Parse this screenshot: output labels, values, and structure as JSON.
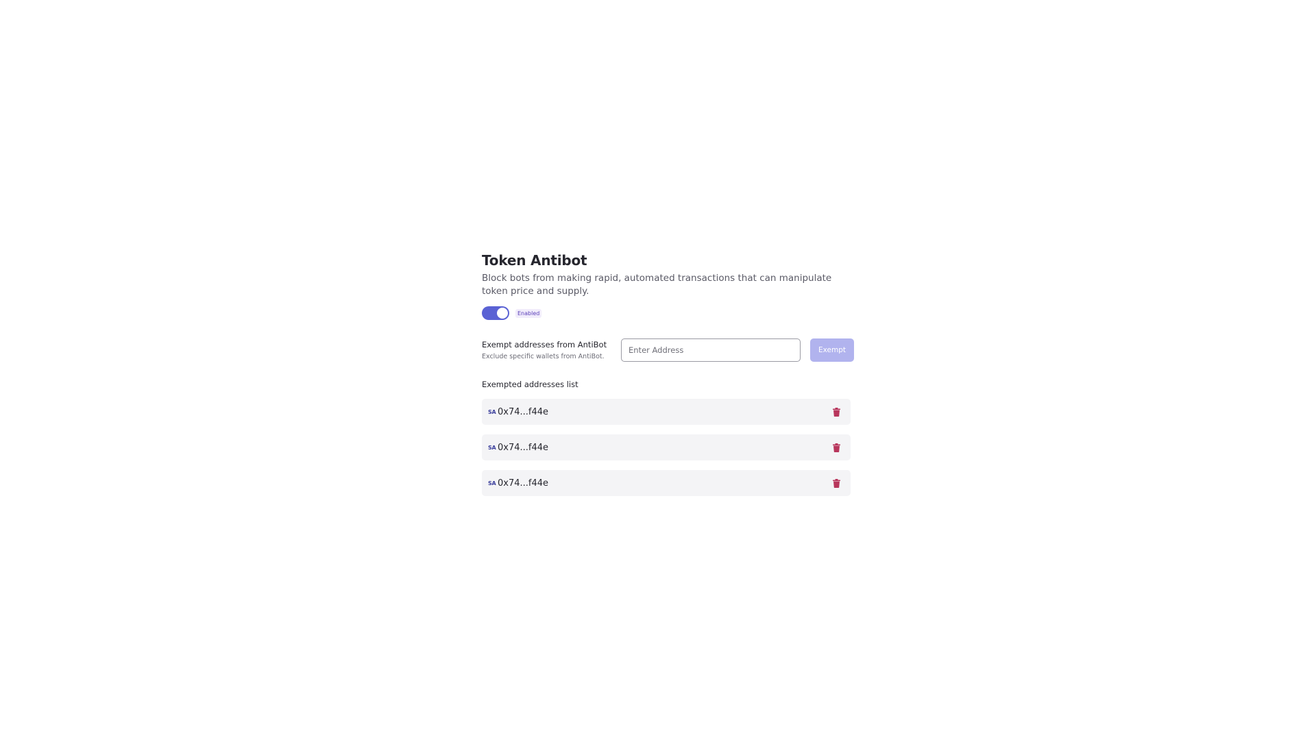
{
  "header": {
    "title": "Token Antibot",
    "description": "Block bots from making rapid, automated transactions that can manipulate token price and supply."
  },
  "toggle": {
    "state": "on",
    "label": "Enabled",
    "accent_color": "#5a62d4"
  },
  "exempt": {
    "label": "Exempt addresses from AntiBot",
    "hint": "Exclude specific wallets from AntiBot.",
    "input_placeholder": "Enter Address",
    "input_value": "",
    "button_label": "Exempt",
    "button_color": "#b1b3ee"
  },
  "list": {
    "heading": "Exempted addresses list",
    "items": [
      {
        "icon_text": "SA",
        "address": "0x74...f44e",
        "delete_icon": "trash-icon"
      },
      {
        "icon_text": "SA",
        "address": "0x74...f44e",
        "delete_icon": "trash-icon"
      },
      {
        "icon_text": "SA",
        "address": "0x74...f44e",
        "delete_icon": "trash-icon"
      }
    ],
    "delete_color": "#b8365c"
  }
}
